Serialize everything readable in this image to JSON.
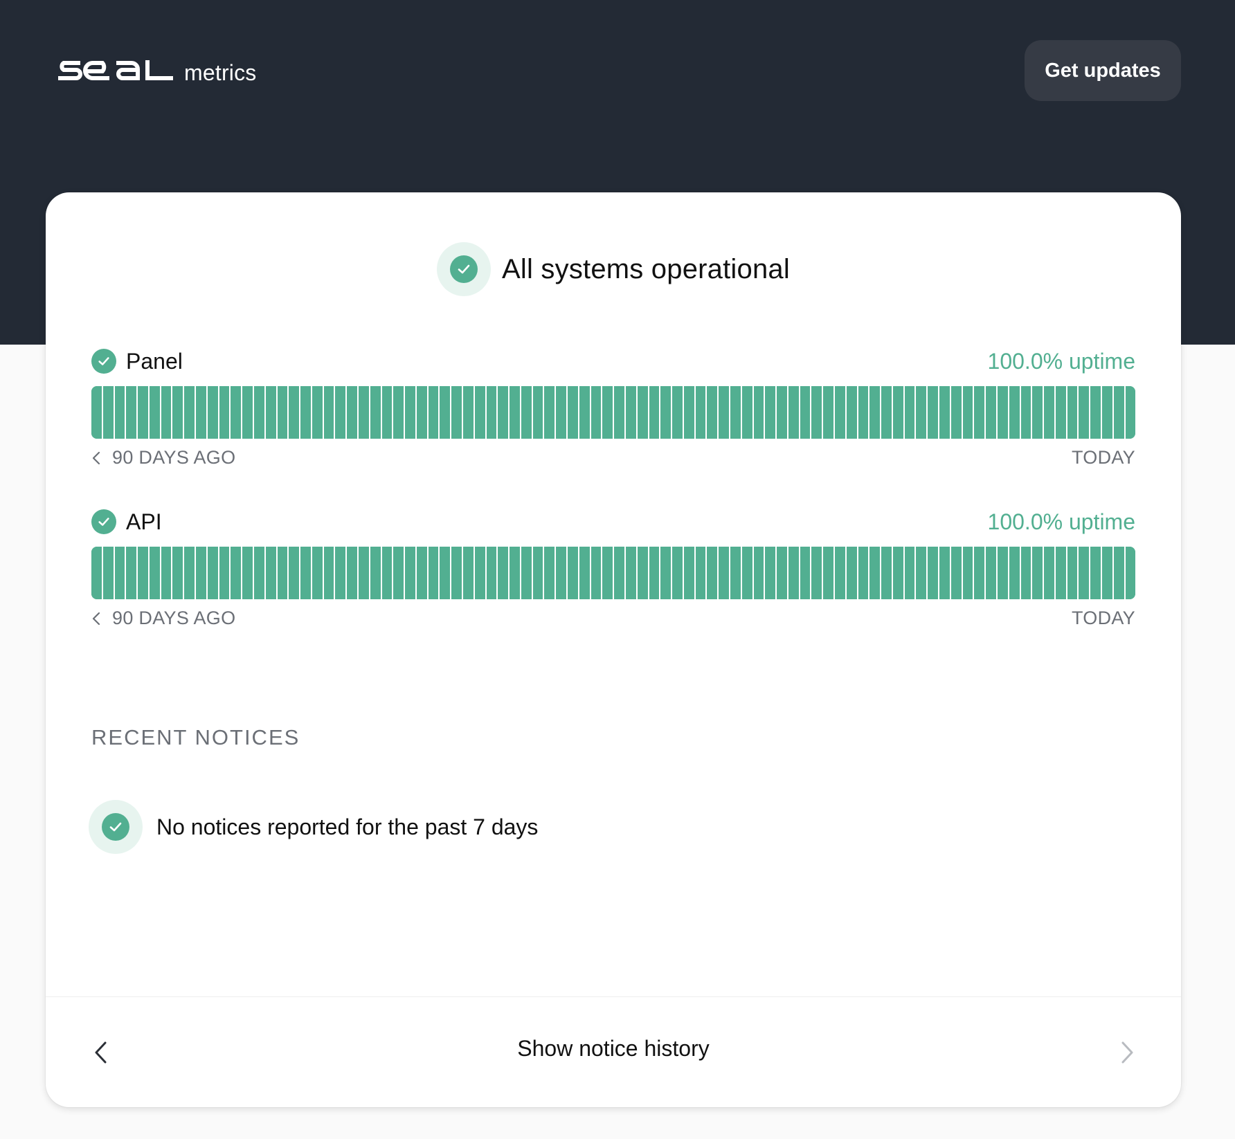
{
  "header": {
    "brand_name": "seal",
    "brand_suffix": "metrics",
    "updates_button": "Get updates"
  },
  "status": {
    "title": "All systems operational",
    "icon": "check-circle-icon",
    "color": "#52af91"
  },
  "components": [
    {
      "name": "Panel",
      "uptime": "100.0% uptime",
      "days": 90,
      "start_label": "90 DAYS AGO",
      "end_label": "TODAY",
      "status_color": "#52af91"
    },
    {
      "name": "API",
      "uptime": "100.0% uptime",
      "days": 90,
      "start_label": "90 DAYS AGO",
      "end_label": "TODAY",
      "status_color": "#52af91"
    }
  ],
  "notices": {
    "title": "RECENT NOTICES",
    "empty_message": "No notices reported for the past 7 days"
  },
  "footer": {
    "history_label": "Show notice history",
    "prev_icon": "chevron-left-icon",
    "next_icon": "chevron-right-icon"
  },
  "colors": {
    "header_background": "#232a35",
    "accent": "#52af91",
    "button_background": "#363b45"
  }
}
